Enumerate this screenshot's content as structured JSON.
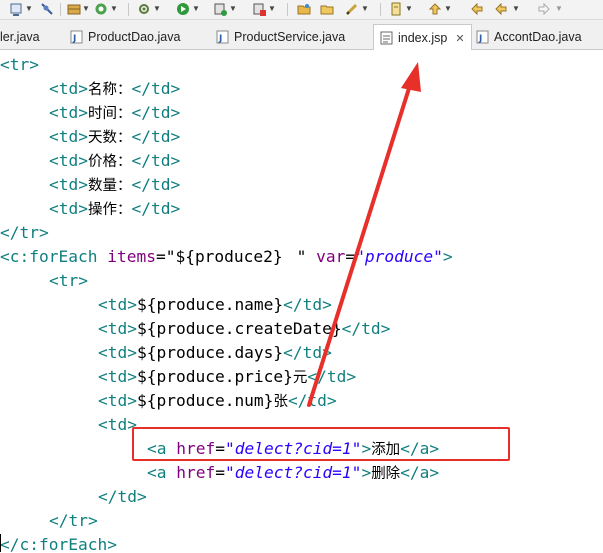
{
  "tabs": [
    {
      "label": "ler.java",
      "active": false
    },
    {
      "label": "ProductDao.java",
      "active": false
    },
    {
      "label": "ProductService.java",
      "active": false
    },
    {
      "label": "index.jsp",
      "active": true
    },
    {
      "label": "AccontDao.java",
      "active": false
    }
  ],
  "tab_close": "✕",
  "code": {
    "l0_open": "<tr>",
    "l1_open": "<td>",
    "l1_text": "名称：",
    "l1_close": "</td>",
    "l2_open": "<td>",
    "l2_text": "时间：",
    "l2_close": "</td>",
    "l3_open": "<td>",
    "l3_text": "天数：",
    "l3_close": "</td>",
    "l4_open": "<td>",
    "l4_text": "价格：",
    "l4_close": "</td>",
    "l5_open": "<td>",
    "l5_text": "数量：",
    "l5_close": "</td>",
    "l6_open": "<td>",
    "l6_text": "操作：",
    "l6_close": "</td>",
    "l7_close": "</tr>",
    "l8_tag": "<c:forEach",
    "l8_attr1": "items",
    "l8_eq1": "=",
    "l8_val1_a": "\"${produce2}",
    "l8_val1_b": "\"",
    "l8_attr2": "var",
    "l8_eq2": "=",
    "l8_val2": "\"produce\"",
    "l8_end": ">",
    "l9_open": "<tr>",
    "l10_open": "<td>",
    "l10_expr": "${produce.name}",
    "l10_close": "</td>",
    "l11_open": "<td>",
    "l11_expr": "${produce.createDate}",
    "l11_close": "</td>",
    "l12_open": "<td>",
    "l12_expr": "${produce.days}",
    "l12_close": "</td>",
    "l13_open": "<td>",
    "l13_expr": "${produce.price}",
    "l13_unit": "元",
    "l13_close": "</td>",
    "l14_open": "<td>",
    "l14_expr": "${produce.num}",
    "l14_unit": "张",
    "l14_close": "</td>",
    "l15_open": "<td>",
    "l16_tag": "<a",
    "l16_attr": "href",
    "l16_eq": "=",
    "l16_val": "\"delect?cid=1\"",
    "l16_gt": ">",
    "l16_text": "添加",
    "l16_close": "</a>",
    "l17_tag": "<a",
    "l17_attr": "href",
    "l17_eq": "=",
    "l17_val": "\"delect?cid=1\"",
    "l17_gt": ">",
    "l17_text": "删除",
    "l17_close": "</a>",
    "l18_close": "</td>",
    "l19_close": "</tr>",
    "l20_close": "</c:forEach>"
  },
  "colors": {
    "tag": "#117f7f",
    "attribute": "#7f007f",
    "string": "#2a00ff",
    "annotation": "#e8302a"
  },
  "icons": [
    "debug-icon",
    "breakpoint-icon",
    "build-icon",
    "refresh-icon",
    "settings-icon",
    "run-icon",
    "server-icon",
    "stop-icon",
    "folder-icon",
    "open-folder-icon",
    "pen-icon",
    "bookmark-icon",
    "nav-up-icon",
    "back-icon",
    "forward-icon"
  ]
}
